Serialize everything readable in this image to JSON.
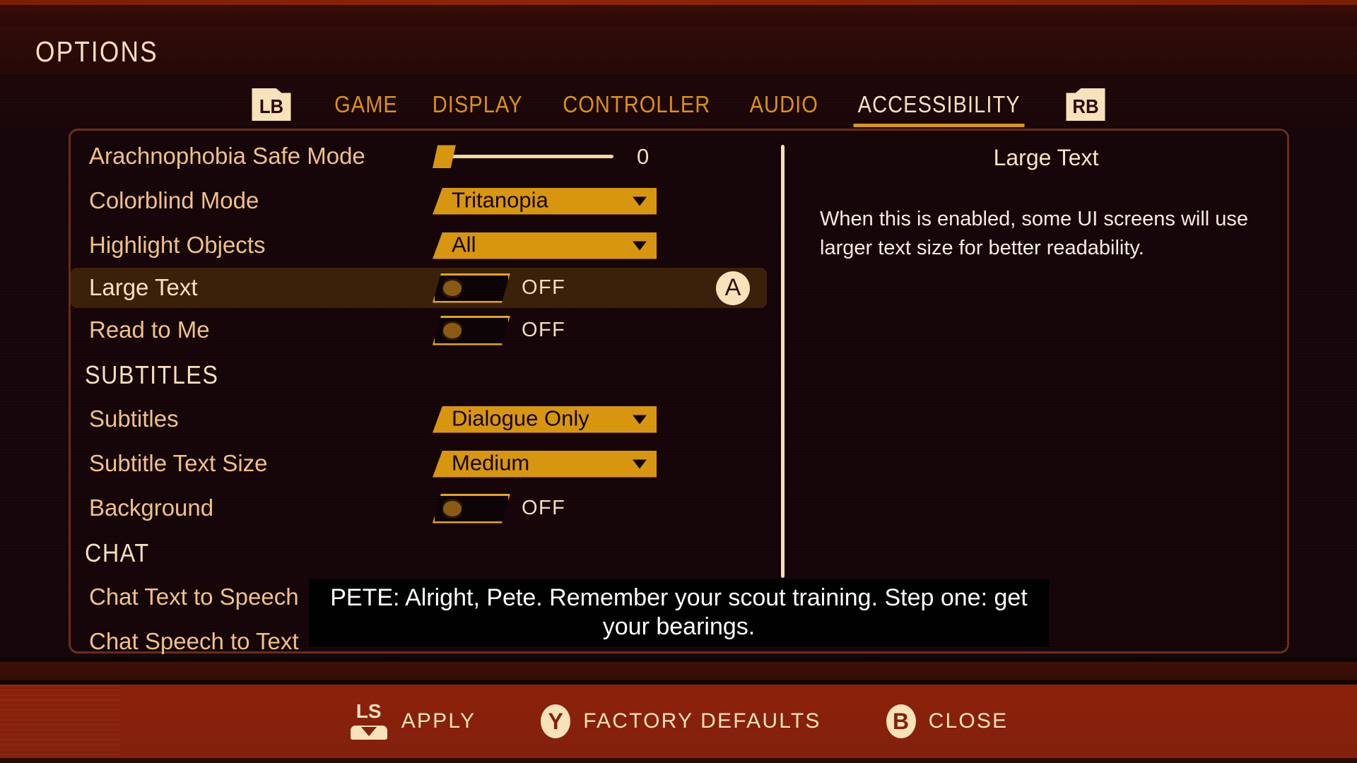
{
  "header": {
    "title": "OPTIONS"
  },
  "tabs": {
    "left_bumper": "LB",
    "right_bumper": "RB",
    "items": [
      {
        "label": "GAME",
        "active": false
      },
      {
        "label": "DISPLAY",
        "active": false
      },
      {
        "label": "CONTROLLER",
        "active": false
      },
      {
        "label": "AUDIO",
        "active": false
      },
      {
        "label": "ACCESSIBILITY",
        "active": true
      }
    ]
  },
  "settings": [
    {
      "name": "Arachnophobia Safe Mode",
      "control": "slider",
      "value": "0",
      "selected": false
    },
    {
      "name": "Colorblind Mode",
      "control": "dropdown",
      "value": "Tritanopia",
      "selected": false
    },
    {
      "name": "Highlight Objects",
      "control": "dropdown",
      "value": "All",
      "selected": false
    },
    {
      "name": "Large Text",
      "control": "toggle",
      "value": "OFF",
      "selected": true,
      "action_glyph": "A"
    },
    {
      "name": "Read to Me",
      "control": "toggle",
      "value": "OFF",
      "selected": false
    },
    {
      "name": "SUBTITLES",
      "control": "section"
    },
    {
      "name": "Subtitles",
      "control": "dropdown",
      "value": "Dialogue Only",
      "selected": false
    },
    {
      "name": "Subtitle Text Size",
      "control": "dropdown",
      "value": "Medium",
      "selected": false
    },
    {
      "name": "Background",
      "control": "toggle",
      "value": "OFF",
      "selected": false
    },
    {
      "name": "CHAT",
      "control": "section"
    },
    {
      "name": "Chat Text to Speech",
      "control": "none",
      "selected": false
    },
    {
      "name": "Chat Speech to Text",
      "control": "none",
      "selected": false,
      "clipped": true
    }
  ],
  "description": {
    "title": "Large Text",
    "body": "When this is enabled, some UI screens will use larger text size for better readability."
  },
  "subtitle_overlay": {
    "line1": "PETE: Alright, Pete. Remember your scout training. Step one: get",
    "line2": "your bearings."
  },
  "action_bar": [
    {
      "glyph": "LS",
      "glyph_type": "stick",
      "label": "APPLY"
    },
    {
      "glyph": "Y",
      "glyph_type": "button",
      "label": "FACTORY DEFAULTS"
    },
    {
      "glyph": "B",
      "glyph_type": "button",
      "label": "CLOSE"
    }
  ],
  "colors": {
    "accent_gold": "#d8960f",
    "cream": "#f7e2ba",
    "label_tan": "#f0c186",
    "bg_dark": "#14060a",
    "action_bar_red": "#8b2009",
    "selected_row": "#3a2008",
    "panel_border": "#6e2a16"
  }
}
